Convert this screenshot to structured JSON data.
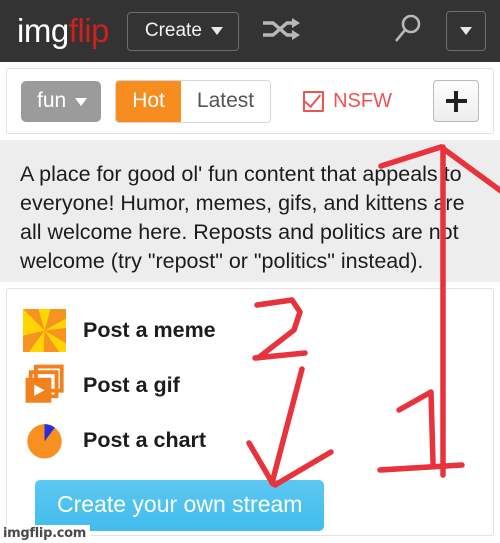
{
  "navbar": {
    "logo_first": "img",
    "logo_second": "flip",
    "create_label": "Create",
    "caret_icon": "chevron-down-icon",
    "shuffle_icon": "shuffle-icon",
    "search_icon": "search-icon",
    "dropdown_icon": "chevron-down-icon",
    "background_color": "#333333"
  },
  "filter_bar": {
    "stream_name": "fun",
    "stream_caret_icon": "chevron-down-icon",
    "sort_options": [
      {
        "label": "Hot",
        "active": true
      },
      {
        "label": "Latest",
        "active": false
      }
    ],
    "nsfw_label": "NSFW",
    "nsfw_checked": true,
    "nsfw_color": "#ef5350",
    "add_button_icon": "plus-icon",
    "active_color": "#f78d1e"
  },
  "description": {
    "text": "A place for good ol' fun content that appeals to everyone! Humor, memes, gifs, and kittens are all welcome here. Reposts and politics are not welcome (try \"repost\" or \"politics\" instead)."
  },
  "post_panel": {
    "items": [
      {
        "label": "Post a meme",
        "icon": "pinwheel-icon"
      },
      {
        "label": "Post a gif",
        "icon": "gif-frames-play-icon"
      },
      {
        "label": "Post a chart",
        "icon": "pie-chart-icon"
      }
    ],
    "create_stream_label": "Create your own stream",
    "create_stream_color": "#4ec1ec"
  },
  "watermark": {
    "text": "imgflip.com"
  },
  "annotations": {
    "color": "#e8323c",
    "marks": [
      {
        "name": "number-one",
        "text": "1"
      },
      {
        "name": "number-two",
        "text": "2"
      },
      {
        "name": "arrow-up-to-plus-button"
      },
      {
        "name": "arrow-down-to-create-stream-button"
      }
    ]
  }
}
